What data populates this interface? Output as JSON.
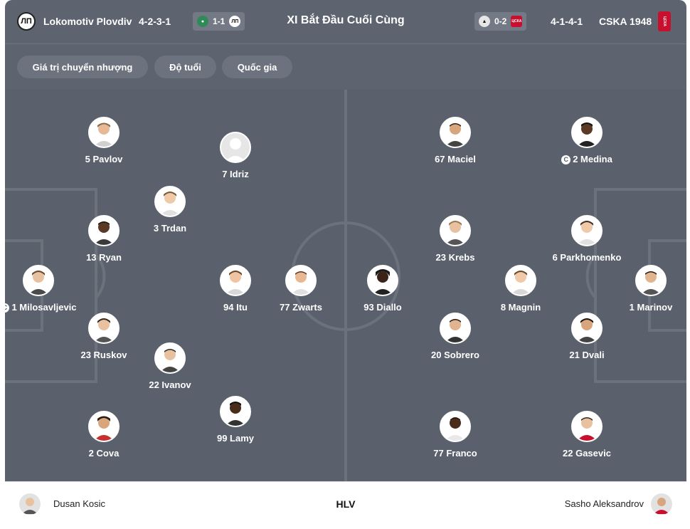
{
  "header": {
    "title": "XI Bắt Đầu Cuối Cùng",
    "home": {
      "name": "Lokomotiv Plovdiv",
      "logo_text": "ЛП",
      "formation": "4-2-3-1",
      "last_score": "1-1",
      "last_logo_text": "ЛП"
    },
    "away": {
      "name": "CSKA 1948",
      "logo_text": "ЦСКА",
      "formation": "4-1-4-1",
      "last_score": "0-2",
      "last_logo_text": "ЦСКА"
    }
  },
  "tabs": [
    "Giá trị chuyển nhượng",
    "Độ tuổi",
    "Quốc gia"
  ],
  "home_players": [
    {
      "label": "1 Milosavljevic",
      "captain": true
    },
    {
      "label": "5 Pavlov",
      "captain": false
    },
    {
      "label": "13 Ryan",
      "captain": false
    },
    {
      "label": "23 Ruskov",
      "captain": false
    },
    {
      "label": "2 Cova",
      "captain": false
    },
    {
      "label": "3 Trdan",
      "captain": false
    },
    {
      "label": "22 Ivanov",
      "captain": false
    },
    {
      "label": "7 Idriz",
      "captain": false
    },
    {
      "label": "94 Itu",
      "captain": false
    },
    {
      "label": "99 Lamy",
      "captain": false
    },
    {
      "label": "77 Zwarts",
      "captain": false
    }
  ],
  "away_players": [
    {
      "label": "93 Diallo",
      "captain": false
    },
    {
      "label": "67 Maciel",
      "captain": false
    },
    {
      "label": "23 Krebs",
      "captain": false
    },
    {
      "label": "20 Sobrero",
      "captain": false
    },
    {
      "label": "77 Franco",
      "captain": false
    },
    {
      "label": "8 Magnin",
      "captain": false
    },
    {
      "label": "2 Medina",
      "captain": true
    },
    {
      "label": "6 Parkhomenko",
      "captain": false
    },
    {
      "label": "21 Dvali",
      "captain": false
    },
    {
      "label": "22 Gasevic",
      "captain": false
    },
    {
      "label": "1 Marinov",
      "captain": false
    }
  ],
  "captain_mark": "C",
  "coaches": {
    "label": "HLV",
    "home": "Dusan Kosic",
    "away": "Sasho Aleksandrov"
  },
  "colors": {
    "header_bg": "#5d6470",
    "pitch_bg": "#5a616c",
    "pitch_lines": "#6b727c",
    "text": "#ffffff"
  }
}
